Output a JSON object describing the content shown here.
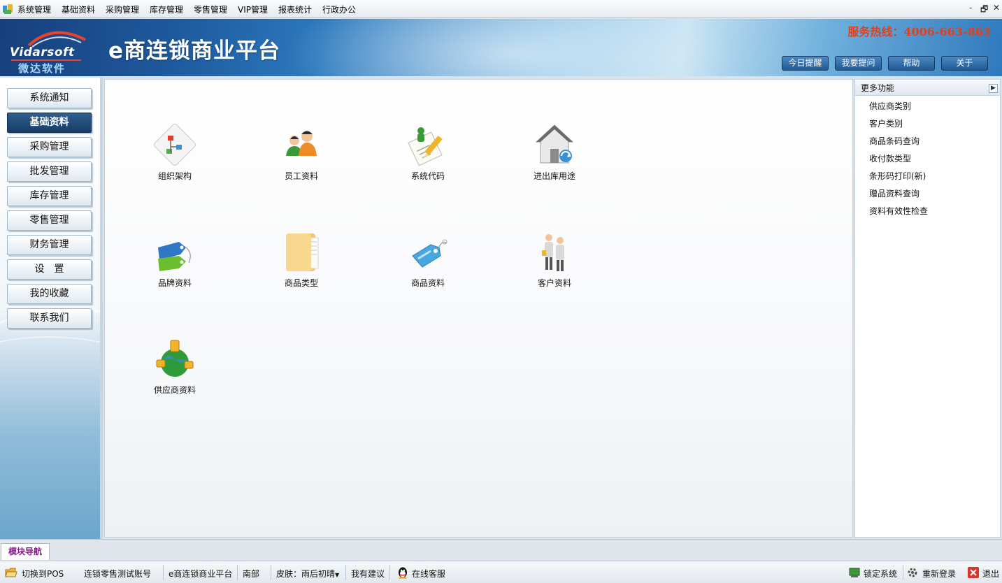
{
  "menubar": {
    "items": [
      "系统管理",
      "基础资料",
      "采购管理",
      "库存管理",
      "零售管理",
      "VIP管理",
      "报表统计",
      "行政办公"
    ],
    "window_controls": [
      "-",
      "🗗",
      "✕"
    ]
  },
  "header": {
    "logo_text": "Vidarsoft",
    "logo_sub": "微达软件",
    "title": "e商连锁商业平台",
    "hotline": "服务热线：4006-663-863",
    "buttons": [
      "今日提醒",
      "我要提问",
      "帮助",
      "关于"
    ]
  },
  "leftnav": {
    "items": [
      "系统通知",
      "基础资料",
      "采购管理",
      "批发管理",
      "库存管理",
      "零售管理",
      "财务管理",
      "设　置",
      "我的收藏",
      "联系我们"
    ],
    "active_index": 1
  },
  "main": {
    "modules": [
      {
        "label": "组织架构",
        "icon": "org-chart-icon"
      },
      {
        "label": "员工资料",
        "icon": "employees-icon"
      },
      {
        "label": "系统代码",
        "icon": "system-code-icon"
      },
      {
        "label": "进出库用途",
        "icon": "warehouse-house-icon"
      },
      {
        "label": "品牌资料",
        "icon": "brand-tags-icon"
      },
      {
        "label": "商品类型",
        "icon": "folder-icon"
      },
      {
        "label": "商品资料",
        "icon": "product-tag-icon"
      },
      {
        "label": "客户资料",
        "icon": "customers-icon"
      },
      {
        "label": "供应商资料",
        "icon": "supplier-globe-icon"
      }
    ]
  },
  "rightpanel": {
    "title": "更多功能",
    "items": [
      "供应商类别",
      "客户类别",
      "商品条码查询",
      "收付款类型",
      "条形码打印(新)",
      "赠品资料查询",
      "资料有效性检查"
    ]
  },
  "tabstrip": {
    "tab": "模块导航"
  },
  "statusbar": {
    "switch_pos": "切换到POS",
    "account": "连锁零售测试账号",
    "platform": "e商连锁商业平台",
    "region": "南部",
    "skin": "皮肤：雨后初晴",
    "suggest": "我有建议",
    "online_service": "在线客服",
    "lock": "锁定系统",
    "relogin": "重新登录",
    "exit": "退出"
  },
  "colors": {
    "accent": "#1f5a96",
    "hotline": "#e2401b",
    "active_nav": "#173d66",
    "tab_text": "#8a1a8a"
  }
}
